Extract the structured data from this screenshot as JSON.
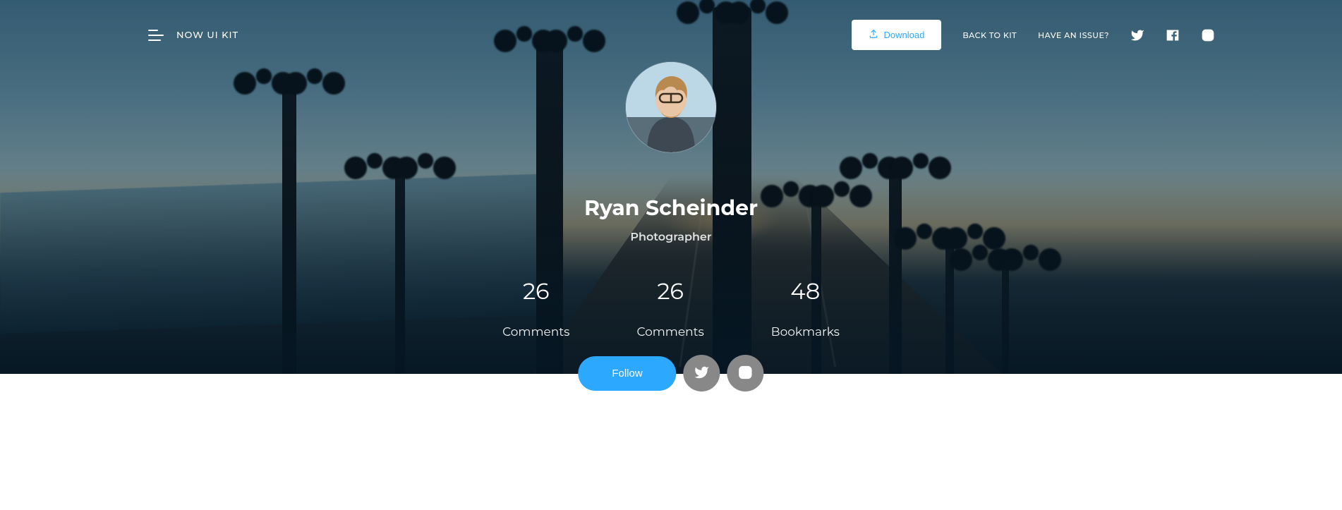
{
  "nav": {
    "brand": "NOW UI KIT",
    "download": "Download",
    "back_to_kit": "BACK TO KIT",
    "have_issue": "HAVE AN ISSUE?"
  },
  "profile": {
    "name": "Ryan Scheinder",
    "role": "Photographer"
  },
  "stats": [
    {
      "value": "26",
      "label": "Comments"
    },
    {
      "value": "26",
      "label": "Comments"
    },
    {
      "value": "48",
      "label": "Bookmarks"
    }
  ],
  "actions": {
    "follow": "Follow"
  },
  "colors": {
    "primary": "#2ca8ff",
    "neutral": "#888888"
  }
}
